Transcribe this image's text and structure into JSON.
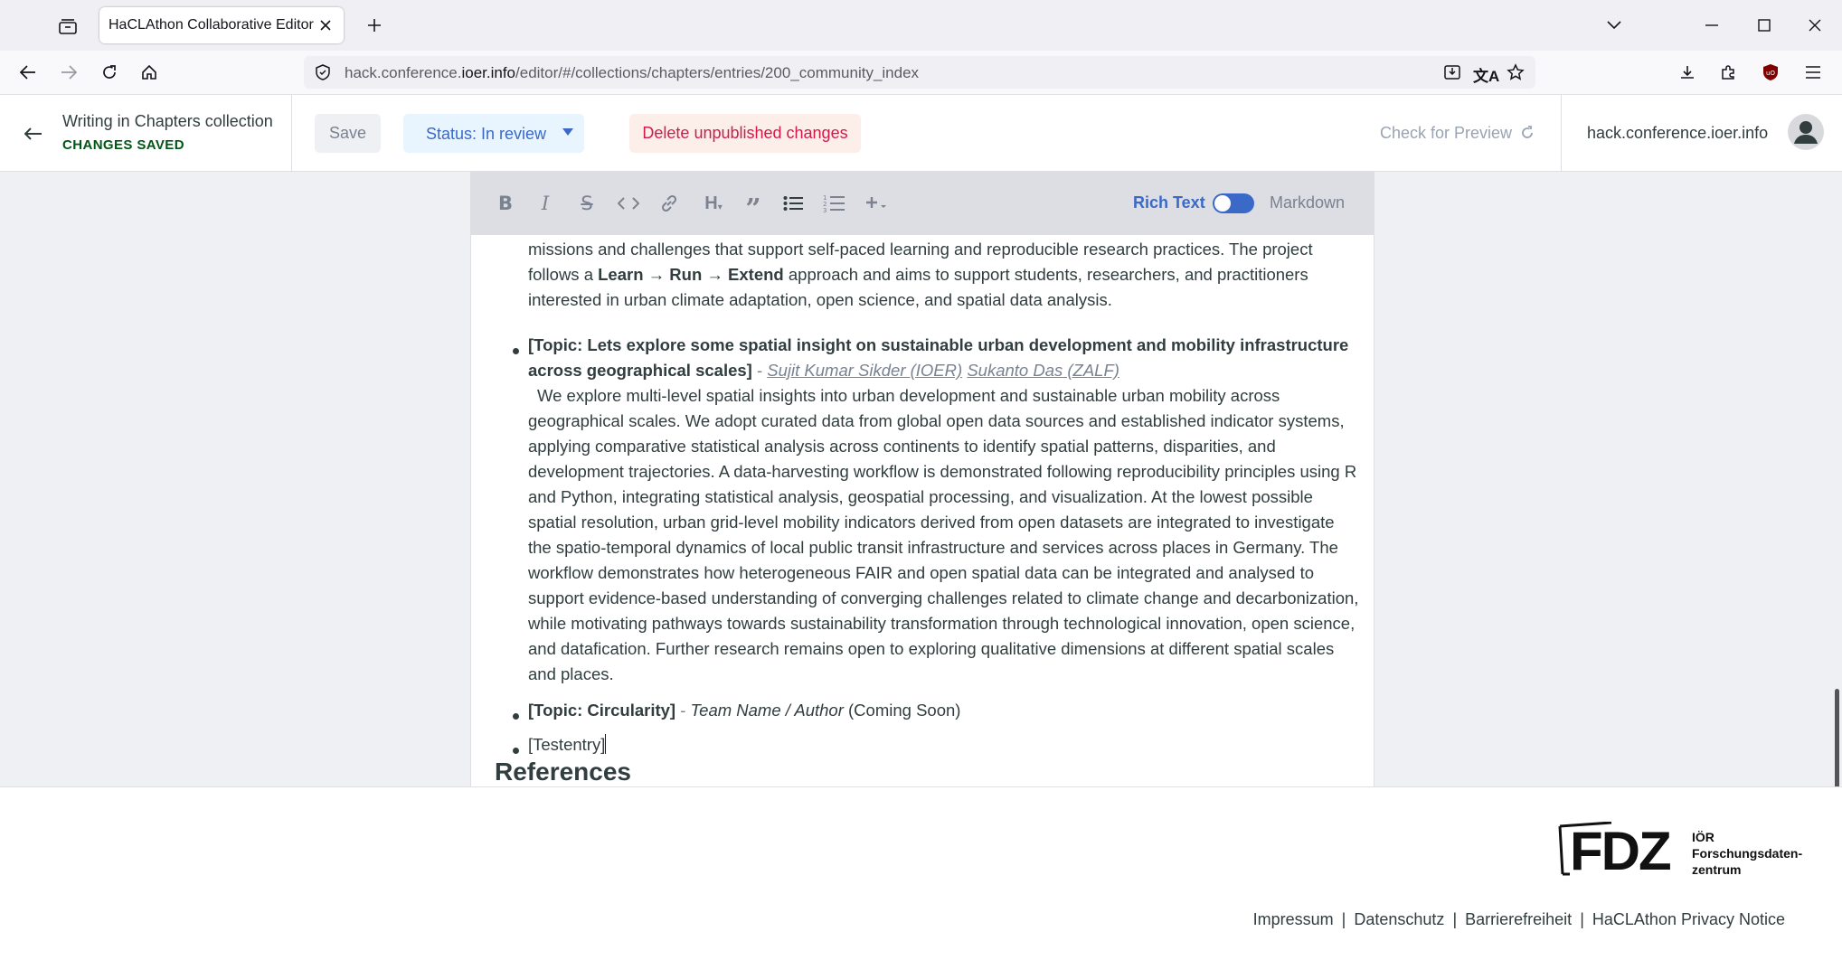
{
  "browser": {
    "tab_title": "HaCLAthon Collaborative Editor",
    "url_prefix": "hack.conference.",
    "url_domain": "ioer.info",
    "url_path": "/editor/#/collections/chapters/entries/200_community_index"
  },
  "cms": {
    "collection_title": "Writing in Chapters collection",
    "save_status": "CHANGES SAVED",
    "save_label": "Save",
    "status_label": "Status: In review",
    "delete_label": "Delete unpublished changes",
    "check_preview": "Check for Preview",
    "site_link": "hack.conference.ioer.info"
  },
  "editor": {
    "mode_rich": "Rich Text",
    "mode_markdown": "Markdown",
    "para1": {
      "line1": "missions and challenges that support self-paced learning and reproducible research practices. The project",
      "pre": "follows a ",
      "b1": "Learn",
      "arrow1": " → ",
      "b2": "Run",
      "arrow2": " → ",
      "b3": "Extend",
      "post": " approach and aims to support students, researchers, and practitioners",
      "line3": "interested in urban climate adaptation, open science, and spatial data analysis."
    },
    "item1": {
      "title": "[Topic: Lets explore some spatial insight on sustainable urban development and mobility infrastructure across geographical scales]",
      "dash": " - ",
      "author1": "Sujit Kumar Sikder (IOER)",
      "author2": "Sukanto Das (ZALF)",
      "body": "We explore multi-level spatial insights into urban development and sustainable urban mobility across geographical scales. We adopt curated data from global open data sources and established indicator systems, applying comparative statistical analysis across continents to identify spatial patterns, disparities, and development trajectories. A data-harvesting workflow is demonstrated following reproducibility principles using R and Python, integrating statistical analysis, geospatial processing, and visualization. At the lowest possible spatial resolution, urban grid-level mobility indicators derived from open datasets are integrated to investigate the spatio-temporal dynamics of local public transit infrastructure and services across places in Germany. The workflow demonstrates how heterogeneous FAIR and open spatial data can be integrated and analysed to support evidence-based understanding of converging challenges related to climate change and decarbonization, while motivating pathways towards sustainability transformation through technological innovation, open science, and datafication. Further research remains open to exploring qualitative dimensions at different spatial scales and places."
    },
    "item2": {
      "title": "[Topic: Circularity]",
      "dash": " - ",
      "author": "Team Name / Author",
      "note": " (Coming Soon)"
    },
    "item3": {
      "text": "[Testentry]"
    },
    "references_heading": "References"
  },
  "footer": {
    "logo_text": "FDZ",
    "logo_sub1": "IÖR",
    "logo_sub2": "Forschungsdaten-",
    "logo_sub3": "zentrum",
    "links": [
      "Impressum",
      "Datenschutz",
      "Barrierefreiheit",
      "HaCLAthon Privacy Notice"
    ],
    "separator": "|"
  }
}
